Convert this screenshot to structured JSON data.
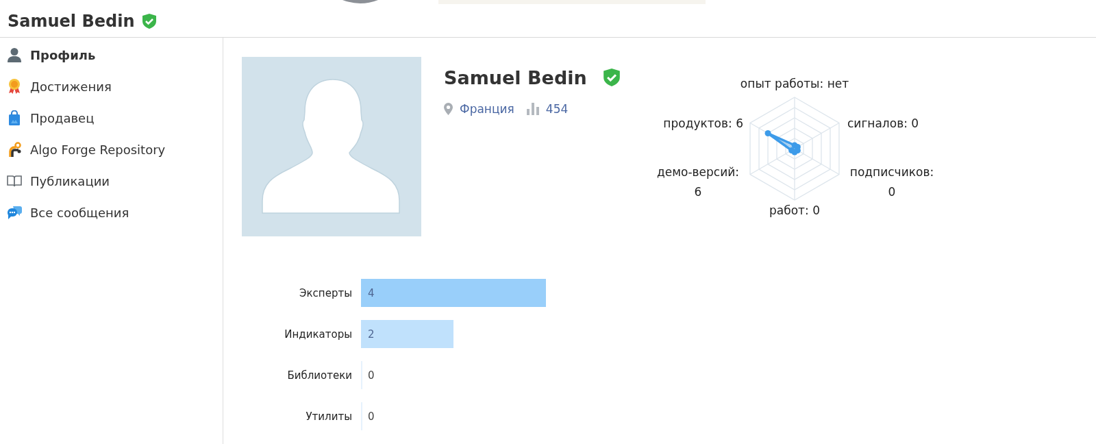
{
  "header": {
    "title": "Samuel Bedin",
    "verified": true
  },
  "sidebar": {
    "items": [
      {
        "label": "Профиль",
        "kind": "profile",
        "selected": true
      },
      {
        "label": "Достижения",
        "kind": "achievements",
        "selected": false
      },
      {
        "label": "Продавец",
        "kind": "seller",
        "selected": false
      },
      {
        "label": "Algo Forge Repository",
        "kind": "repository",
        "selected": false
      },
      {
        "label": "Публикации",
        "kind": "publications",
        "selected": false
      },
      {
        "label": "Все сообщения",
        "kind": "messages",
        "selected": false
      }
    ]
  },
  "profile": {
    "name": "Samuel Bedin",
    "verified": true,
    "location": "Франция",
    "rating": "454"
  },
  "radar": {
    "labels": [
      "опыт работы: нет",
      "продуктов: 6",
      "сигналов: 0",
      "демо-версий: 6",
      "подписчиков: 0",
      "работ: 0"
    ]
  },
  "chart": {
    "chart_data": {
      "type": "bar",
      "orientation": "horizontal",
      "categories": [
        "Эксперты",
        "Индикаторы",
        "Библиотеки",
        "Утилиты"
      ],
      "values": [
        4,
        2,
        0,
        0
      ],
      "data_labels": true
    }
  }
}
